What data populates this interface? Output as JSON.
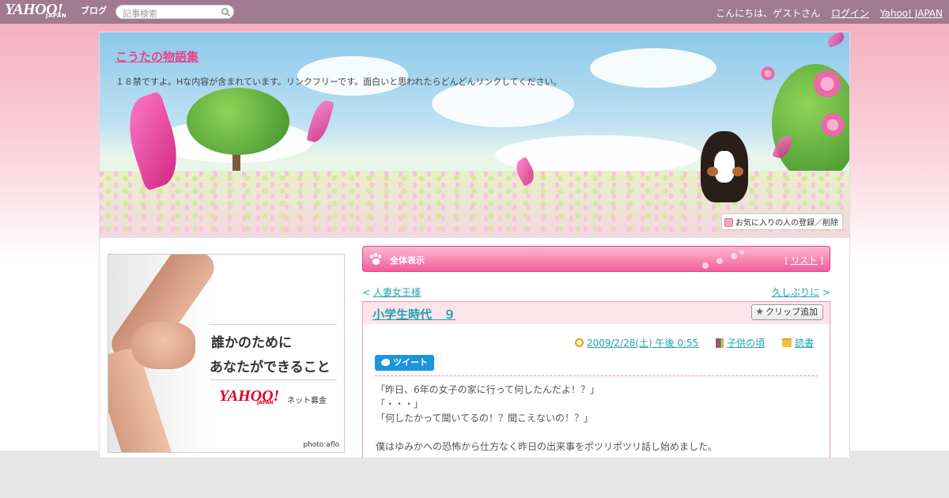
{
  "topbar": {
    "logo": "YAHOO!",
    "logo_sub": "JAPAN",
    "logo_blog": "ブログ",
    "search_placeholder": "記事検索",
    "greeting": "こんにちは、ゲストさん",
    "login": "ログイン",
    "yahoo_japan": "Yahoo! JAPAN"
  },
  "header": {
    "blog_title": "こうたの物語集",
    "description": "１８禁ですよ。Hな内容が含まれています。リンクフリーです。面白いと思われたらどんどんリンクしてください。",
    "favorite_button": "お気に入りの人の登録／削除"
  },
  "ad": {
    "line1": "誰かのために",
    "line2": "あなたができること",
    "logo": "YAHOO!",
    "logo_sub": "JAPAN",
    "tagline": "ネット募金",
    "credit": "photo:aflo"
  },
  "main": {
    "all_view_label": "全体表示",
    "list_open": "[",
    "list_link": "リスト",
    "list_close": "]",
    "prev_arrow": "<",
    "prev_link": "人妻女王様",
    "next_link": "久しぶりに",
    "next_arrow": ">"
  },
  "post": {
    "title": "小学生時代　９",
    "clip_button": "クリップ追加",
    "date": "2009/2/28(土) 午後 0:55",
    "category": "子供の頃",
    "subcategory": "読書",
    "tweet_button": "ツイート",
    "body": [
      "「昨日、6年の女子の家に行って何したんだよ！？」",
      "「・・・」",
      "「何したかって聞いてるの！？聞こえないの！？」",
      "",
      "僕はゆみかへの恐怖から仕方なく昨日の出来事をポツリポツリ話し始めました。"
    ]
  }
}
